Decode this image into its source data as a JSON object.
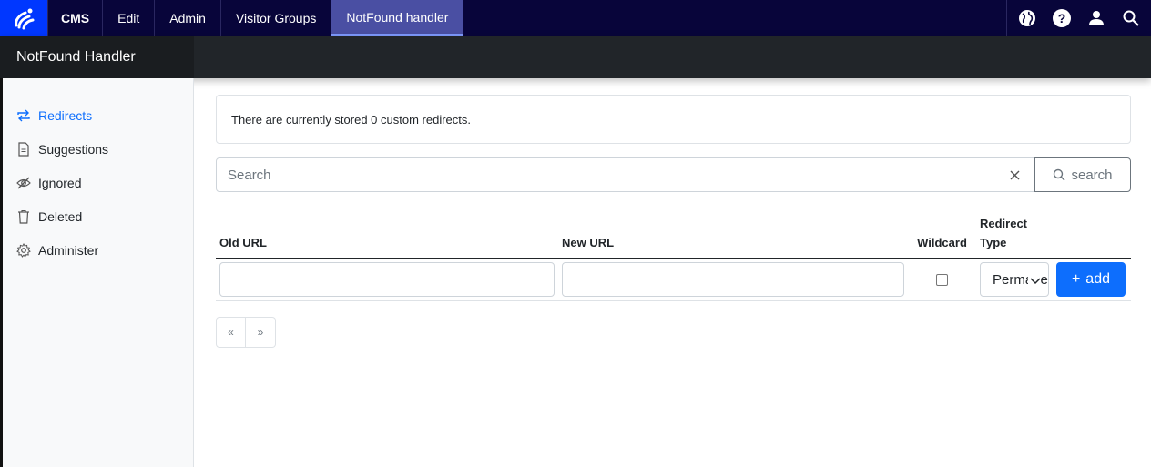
{
  "topnav": {
    "logo": "optimizely-logo",
    "items": [
      {
        "label": "CMS"
      },
      {
        "label": "Edit"
      },
      {
        "label": "Admin"
      },
      {
        "label": "Visitor Groups"
      },
      {
        "label": "NotFound handler",
        "active": true
      }
    ],
    "icons": [
      "globe-icon",
      "help-icon",
      "user-icon",
      "search-icon"
    ]
  },
  "subheader": {
    "title": "NotFound Handler"
  },
  "sidebar": {
    "items": [
      {
        "label": "Redirects",
        "icon": "redirect-arrows-icon",
        "active": true
      },
      {
        "label": "Suggestions",
        "icon": "document-icon"
      },
      {
        "label": "Ignored",
        "icon": "eye-slash-icon"
      },
      {
        "label": "Deleted",
        "icon": "trash-icon"
      },
      {
        "label": "Administer",
        "icon": "gear-icon"
      }
    ]
  },
  "main": {
    "alert": "There are currently stored 0 custom redirects.",
    "search": {
      "placeholder": "Search",
      "button_label": "search"
    },
    "table": {
      "headers": {
        "old_url": "Old URL",
        "new_url": "New URL",
        "wildcard": "Wildcard",
        "redirect_type": "Redirect Type"
      },
      "new_row": {
        "old_url": "",
        "new_url": "",
        "wildcard": false,
        "redirect_type": "Permanent",
        "add_label": "add"
      }
    },
    "pager": {
      "prev": "«",
      "next": "»"
    }
  },
  "colors": {
    "topbar": "#08053a",
    "logo_bg": "#0037ff",
    "active_tab": "#4a4fa3",
    "accent": "#0d6efd"
  }
}
